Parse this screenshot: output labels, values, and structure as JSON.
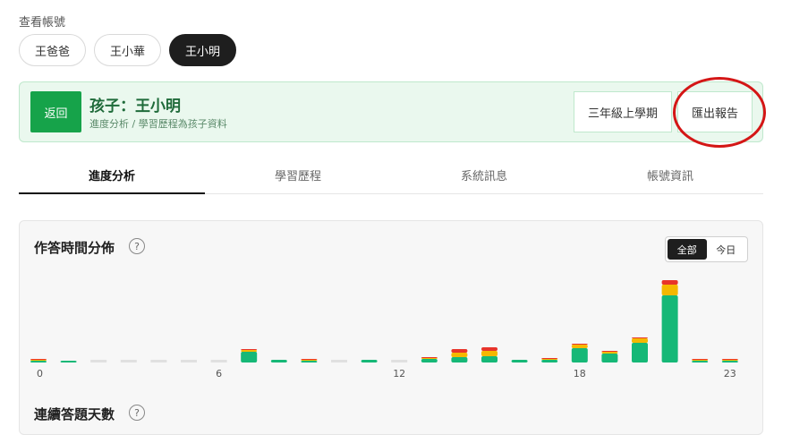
{
  "accounts": {
    "label": "查看帳號",
    "items": [
      "王爸爸",
      "王小華",
      "王小明"
    ],
    "active_index": 2
  },
  "banner": {
    "back_label": "返回",
    "title": "孩子：王小明",
    "subtitle": "進度分析 / 學習歷程為孩子資料",
    "semester_label": "三年級上學期",
    "export_label": "匯出報告"
  },
  "tabs": [
    "進度分析",
    "學習歷程",
    "系統訊息",
    "帳號資訊"
  ],
  "active_tab": 0,
  "card": {
    "title": "作答時間分佈",
    "help": "?",
    "toggle": {
      "all": "全部",
      "today": "今日",
      "selected": "all"
    },
    "next_title": "連續答題天數",
    "next_help": "?"
  },
  "colors": {
    "green": "#16b877",
    "yellow": "#f5b800",
    "red": "#e8342a",
    "empty": "#e0e0e0",
    "accent": "#16a34a",
    "highlight": "#d41616"
  },
  "chart_data": {
    "type": "bar",
    "stacked": true,
    "categories": [
      0,
      1,
      2,
      3,
      4,
      5,
      6,
      7,
      8,
      9,
      10,
      11,
      12,
      13,
      14,
      15,
      16,
      17,
      18,
      19,
      20,
      21,
      22,
      23
    ],
    "tick_labels": [
      "0",
      "6",
      "12",
      "18",
      "23"
    ],
    "tick_positions": [
      0,
      6,
      12,
      18,
      23
    ],
    "series": [
      {
        "values": [
          2,
          2,
          0,
          0,
          0,
          0,
          0,
          12,
          3,
          2,
          0,
          3,
          0,
          4,
          6,
          7,
          3,
          3,
          16,
          10,
          22,
          75,
          2,
          2
        ]
      },
      {
        "values": [
          1,
          0,
          0,
          0,
          0,
          0,
          0,
          2,
          0,
          1,
          0,
          0,
          0,
          1,
          5,
          6,
          0,
          1,
          4,
          2,
          5,
          12,
          1,
          1
        ]
      },
      {
        "values": [
          1,
          0,
          0,
          0,
          0,
          0,
          0,
          1,
          0,
          1,
          0,
          0,
          0,
          1,
          4,
          4,
          0,
          1,
          1,
          1,
          1,
          5,
          1,
          1
        ]
      }
    ],
    "ylim": [
      0,
      100
    ]
  }
}
